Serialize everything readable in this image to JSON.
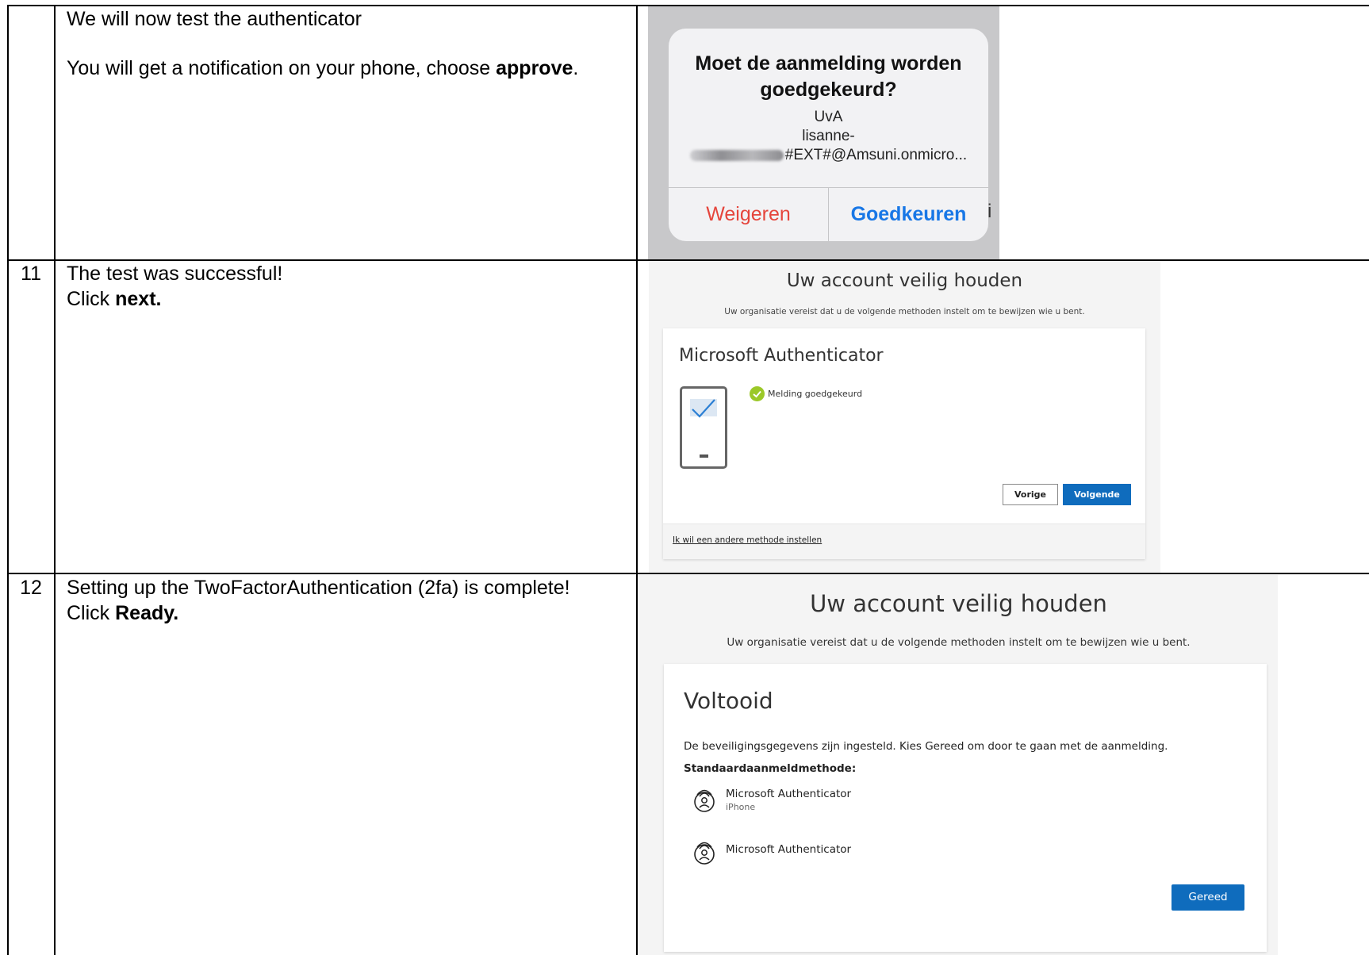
{
  "rows": [
    {
      "number": "",
      "line1": "We will now test the authenticator",
      "line2_pre": "You will get a notification on your phone, choose ",
      "line2_bold": "approve",
      "line2_post": "."
    },
    {
      "number": "11",
      "line1": "The test was successful!",
      "line2_pre": "Click ",
      "line2_bold": "next."
    },
    {
      "number": "12",
      "line1": "Setting up the TwoFactorAuthentication (2fa) is complete!",
      "line2_pre": "Click ",
      "line2_bold": "Ready."
    }
  ],
  "ios_alert": {
    "title_line1": "Moet de aanmelding worden",
    "title_line2": "goedgekeurd?",
    "org": "UvA",
    "account_line1": "lisanne-",
    "account_line2": "#EXT#@Amsuni.onmicro...",
    "deny_label": "Weigeren",
    "approve_label": "Goedkeuren",
    "deny_color": "#e5453c",
    "approve_color": "#1877e6",
    "info_glyph": "i"
  },
  "ms_test": {
    "heading": "Uw account veilig houden",
    "subheading": "Uw organisatie vereist dat u de volgende methoden instelt om te bewijzen wie u bent.",
    "card_title": "Microsoft Authenticator",
    "status": "Melding goedgekeurd",
    "back_label": "Vorige",
    "next_label": "Volgende",
    "other_method_link": "Ik wil een andere methode instellen",
    "success_color": "#9bc828"
  },
  "ms_done": {
    "heading": "Uw account veilig houden",
    "subheading": "Uw organisatie vereist dat u de volgende methoden instelt om te bewijzen wie u bent.",
    "card_title": "Voltooid",
    "description": "De beveiligingsgegevens zijn ingesteld. Kies Gereed om door te gaan met de aanmelding.",
    "default_method_label": "Standaardaanmeldmethode:",
    "methods": [
      {
        "name": "Microsoft Authenticator",
        "detail": "iPhone",
        "icon": "authenticator-icon"
      },
      {
        "name": "Microsoft Authenticator",
        "detail": "",
        "icon": "authenticator-icon"
      }
    ],
    "done_label": "Gereed",
    "accent_color": "#0f6cbd"
  }
}
